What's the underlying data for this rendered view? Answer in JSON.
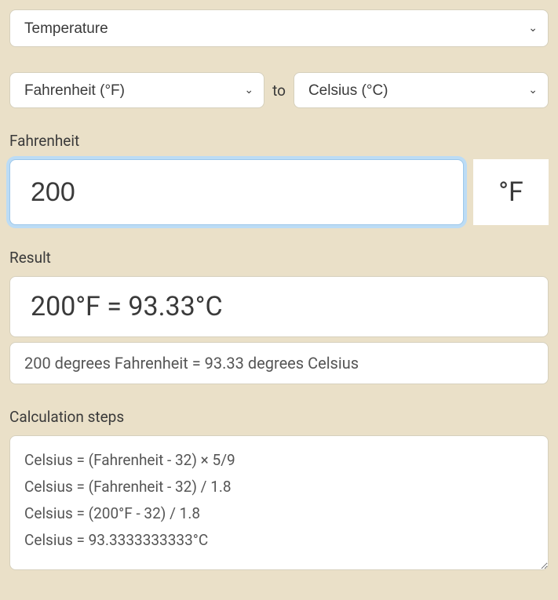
{
  "topSelect": {
    "value": "Temperature"
  },
  "pair": {
    "from": "Fahrenheit (°F)",
    "to_label": "to",
    "to": "Celsius (°C)"
  },
  "input": {
    "label": "Fahrenheit",
    "value": "200",
    "unit": "°F"
  },
  "result": {
    "label": "Result",
    "main": "200°F = 93.33°C",
    "sub": "200 degrees Fahrenheit = 93.33 degrees Celsius"
  },
  "steps": {
    "label": "Calculation steps",
    "lines": [
      "Celsius = (Fahrenheit - 32) × 5/9",
      "Celsius = (Fahrenheit - 32) / 1.8",
      "Celsius = (200°F - 32) / 1.8",
      "Celsius = 93.3333333333°C"
    ]
  }
}
